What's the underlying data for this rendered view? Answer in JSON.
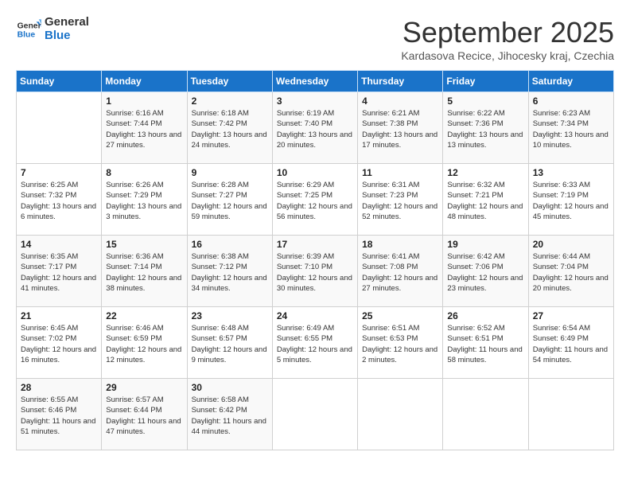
{
  "logo": {
    "line1": "General",
    "line2": "Blue"
  },
  "title": "September 2025",
  "location": "Kardasova Recice, Jihocesky kraj, Czechia",
  "weekdays": [
    "Sunday",
    "Monday",
    "Tuesday",
    "Wednesday",
    "Thursday",
    "Friday",
    "Saturday"
  ],
  "weeks": [
    [
      {
        "day": "",
        "sunrise": "",
        "sunset": "",
        "daylight": ""
      },
      {
        "day": "1",
        "sunrise": "Sunrise: 6:16 AM",
        "sunset": "Sunset: 7:44 PM",
        "daylight": "Daylight: 13 hours and 27 minutes."
      },
      {
        "day": "2",
        "sunrise": "Sunrise: 6:18 AM",
        "sunset": "Sunset: 7:42 PM",
        "daylight": "Daylight: 13 hours and 24 minutes."
      },
      {
        "day": "3",
        "sunrise": "Sunrise: 6:19 AM",
        "sunset": "Sunset: 7:40 PM",
        "daylight": "Daylight: 13 hours and 20 minutes."
      },
      {
        "day": "4",
        "sunrise": "Sunrise: 6:21 AM",
        "sunset": "Sunset: 7:38 PM",
        "daylight": "Daylight: 13 hours and 17 minutes."
      },
      {
        "day": "5",
        "sunrise": "Sunrise: 6:22 AM",
        "sunset": "Sunset: 7:36 PM",
        "daylight": "Daylight: 13 hours and 13 minutes."
      },
      {
        "day": "6",
        "sunrise": "Sunrise: 6:23 AM",
        "sunset": "Sunset: 7:34 PM",
        "daylight": "Daylight: 13 hours and 10 minutes."
      }
    ],
    [
      {
        "day": "7",
        "sunrise": "Sunrise: 6:25 AM",
        "sunset": "Sunset: 7:32 PM",
        "daylight": "Daylight: 13 hours and 6 minutes."
      },
      {
        "day": "8",
        "sunrise": "Sunrise: 6:26 AM",
        "sunset": "Sunset: 7:29 PM",
        "daylight": "Daylight: 13 hours and 3 minutes."
      },
      {
        "day": "9",
        "sunrise": "Sunrise: 6:28 AM",
        "sunset": "Sunset: 7:27 PM",
        "daylight": "Daylight: 12 hours and 59 minutes."
      },
      {
        "day": "10",
        "sunrise": "Sunrise: 6:29 AM",
        "sunset": "Sunset: 7:25 PM",
        "daylight": "Daylight: 12 hours and 56 minutes."
      },
      {
        "day": "11",
        "sunrise": "Sunrise: 6:31 AM",
        "sunset": "Sunset: 7:23 PM",
        "daylight": "Daylight: 12 hours and 52 minutes."
      },
      {
        "day": "12",
        "sunrise": "Sunrise: 6:32 AM",
        "sunset": "Sunset: 7:21 PM",
        "daylight": "Daylight: 12 hours and 48 minutes."
      },
      {
        "day": "13",
        "sunrise": "Sunrise: 6:33 AM",
        "sunset": "Sunset: 7:19 PM",
        "daylight": "Daylight: 12 hours and 45 minutes."
      }
    ],
    [
      {
        "day": "14",
        "sunrise": "Sunrise: 6:35 AM",
        "sunset": "Sunset: 7:17 PM",
        "daylight": "Daylight: 12 hours and 41 minutes."
      },
      {
        "day": "15",
        "sunrise": "Sunrise: 6:36 AM",
        "sunset": "Sunset: 7:14 PM",
        "daylight": "Daylight: 12 hours and 38 minutes."
      },
      {
        "day": "16",
        "sunrise": "Sunrise: 6:38 AM",
        "sunset": "Sunset: 7:12 PM",
        "daylight": "Daylight: 12 hours and 34 minutes."
      },
      {
        "day": "17",
        "sunrise": "Sunrise: 6:39 AM",
        "sunset": "Sunset: 7:10 PM",
        "daylight": "Daylight: 12 hours and 30 minutes."
      },
      {
        "day": "18",
        "sunrise": "Sunrise: 6:41 AM",
        "sunset": "Sunset: 7:08 PM",
        "daylight": "Daylight: 12 hours and 27 minutes."
      },
      {
        "day": "19",
        "sunrise": "Sunrise: 6:42 AM",
        "sunset": "Sunset: 7:06 PM",
        "daylight": "Daylight: 12 hours and 23 minutes."
      },
      {
        "day": "20",
        "sunrise": "Sunrise: 6:44 AM",
        "sunset": "Sunset: 7:04 PM",
        "daylight": "Daylight: 12 hours and 20 minutes."
      }
    ],
    [
      {
        "day": "21",
        "sunrise": "Sunrise: 6:45 AM",
        "sunset": "Sunset: 7:02 PM",
        "daylight": "Daylight: 12 hours and 16 minutes."
      },
      {
        "day": "22",
        "sunrise": "Sunrise: 6:46 AM",
        "sunset": "Sunset: 6:59 PM",
        "daylight": "Daylight: 12 hours and 12 minutes."
      },
      {
        "day": "23",
        "sunrise": "Sunrise: 6:48 AM",
        "sunset": "Sunset: 6:57 PM",
        "daylight": "Daylight: 12 hours and 9 minutes."
      },
      {
        "day": "24",
        "sunrise": "Sunrise: 6:49 AM",
        "sunset": "Sunset: 6:55 PM",
        "daylight": "Daylight: 12 hours and 5 minutes."
      },
      {
        "day": "25",
        "sunrise": "Sunrise: 6:51 AM",
        "sunset": "Sunset: 6:53 PM",
        "daylight": "Daylight: 12 hours and 2 minutes."
      },
      {
        "day": "26",
        "sunrise": "Sunrise: 6:52 AM",
        "sunset": "Sunset: 6:51 PM",
        "daylight": "Daylight: 11 hours and 58 minutes."
      },
      {
        "day": "27",
        "sunrise": "Sunrise: 6:54 AM",
        "sunset": "Sunset: 6:49 PM",
        "daylight": "Daylight: 11 hours and 54 minutes."
      }
    ],
    [
      {
        "day": "28",
        "sunrise": "Sunrise: 6:55 AM",
        "sunset": "Sunset: 6:46 PM",
        "daylight": "Daylight: 11 hours and 51 minutes."
      },
      {
        "day": "29",
        "sunrise": "Sunrise: 6:57 AM",
        "sunset": "Sunset: 6:44 PM",
        "daylight": "Daylight: 11 hours and 47 minutes."
      },
      {
        "day": "30",
        "sunrise": "Sunrise: 6:58 AM",
        "sunset": "Sunset: 6:42 PM",
        "daylight": "Daylight: 11 hours and 44 minutes."
      },
      {
        "day": "",
        "sunrise": "",
        "sunset": "",
        "daylight": ""
      },
      {
        "day": "",
        "sunrise": "",
        "sunset": "",
        "daylight": ""
      },
      {
        "day": "",
        "sunrise": "",
        "sunset": "",
        "daylight": ""
      },
      {
        "day": "",
        "sunrise": "",
        "sunset": "",
        "daylight": ""
      }
    ]
  ]
}
